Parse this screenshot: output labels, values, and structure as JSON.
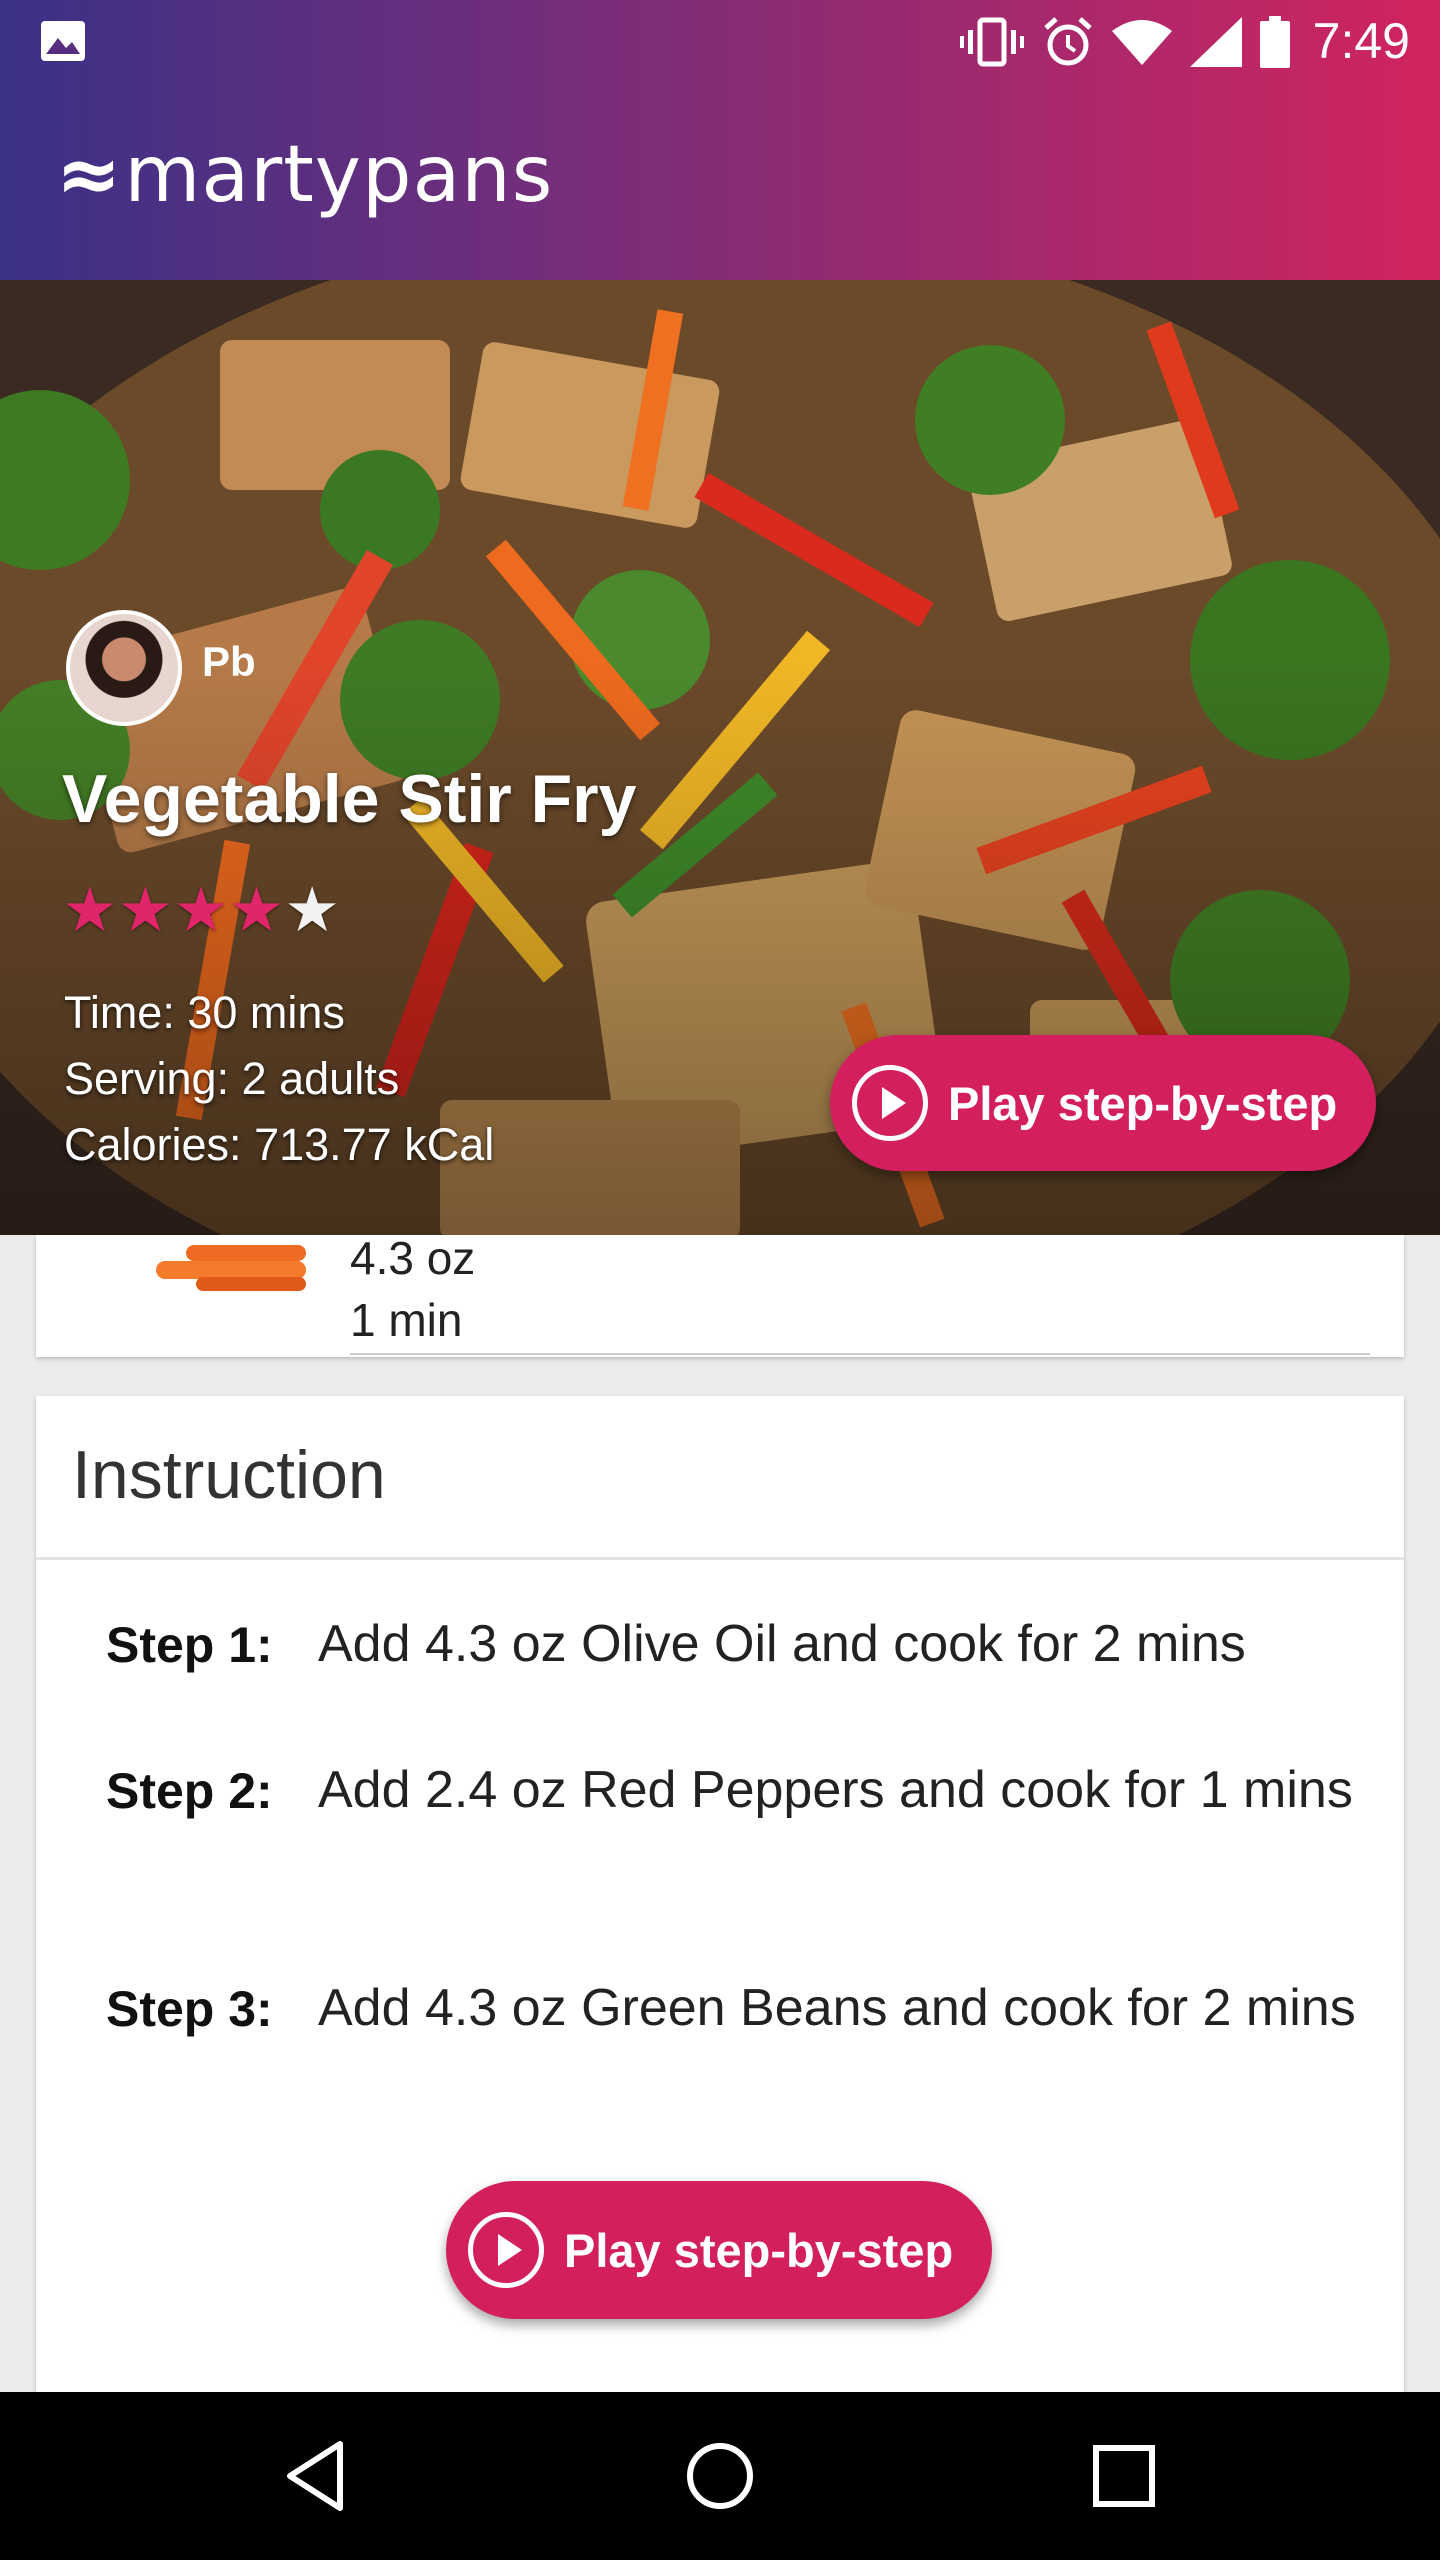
{
  "status_bar": {
    "time": "7:49",
    "left_icon": "image-notification-icon",
    "icons": [
      "vibrate-icon",
      "alarm-icon",
      "wifi-icon",
      "signal-icon",
      "battery-icon"
    ]
  },
  "app_bar": {
    "logo_text": "martypans",
    "brand_color": "#d41f5f"
  },
  "recipe": {
    "author": "Pb",
    "title": "Vegetable Stir Fry",
    "rating": 4,
    "rating_max": 5,
    "time": "Time: 30 mins",
    "serving": "Serving: 2 adults",
    "calories": "Calories: 713.77 kCal",
    "play_label": "Play step-by-step"
  },
  "ingredient_partial": {
    "amount": "4.3 oz",
    "duration": "1 min"
  },
  "instruction": {
    "title": "Instruction",
    "steps": [
      {
        "label": "Step 1:",
        "text": "Add 4.3 oz Olive Oil and cook for 2 mins"
      },
      {
        "label": "Step 2:",
        "text": "Add 2.4 oz Red Peppers and cook for 1 mins"
      },
      {
        "label": "Step 3:",
        "text": "Add 4.3 oz Green Beans and cook for 2 mins"
      }
    ],
    "play_label": "Play step-by-step"
  },
  "nav": [
    "back-icon",
    "home-icon",
    "recents-icon"
  ]
}
